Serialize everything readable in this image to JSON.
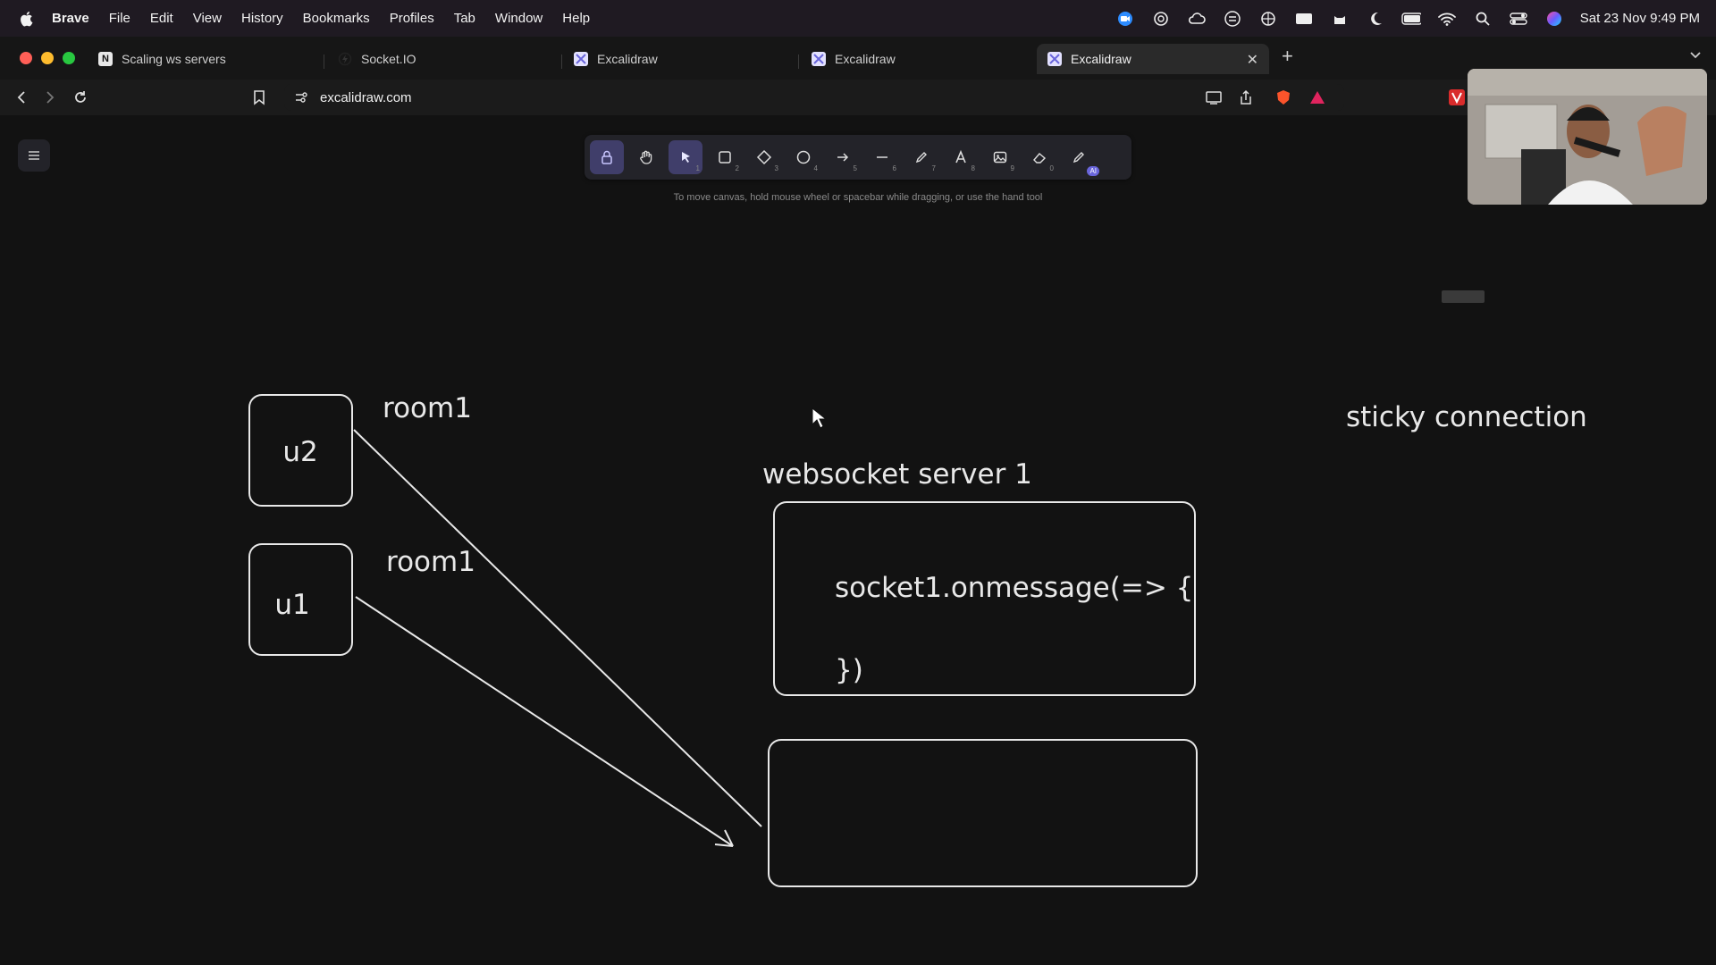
{
  "menubar": {
    "app": "Brave",
    "items": [
      "File",
      "Edit",
      "View",
      "History",
      "Bookmarks",
      "Profiles",
      "Tab",
      "Window",
      "Help"
    ],
    "clock": "Sat 23 Nov  9:49 PM"
  },
  "tabs": [
    {
      "title": "Scaling ws servers",
      "icon": "notion-icon"
    },
    {
      "title": "Socket.IO",
      "icon": "socketio-icon"
    },
    {
      "title": "Excalidraw",
      "icon": "excalidraw-icon"
    },
    {
      "title": "Excalidraw",
      "icon": "excalidraw-icon"
    },
    {
      "title": "Excalidraw",
      "icon": "excalidraw-icon",
      "active": true
    }
  ],
  "address": {
    "url": "excalidraw.com"
  },
  "toolbar": {
    "tools": [
      {
        "name": "lock",
        "key": ""
      },
      {
        "name": "hand",
        "key": ""
      },
      {
        "name": "selection",
        "key": "1"
      },
      {
        "name": "rectangle",
        "key": "2"
      },
      {
        "name": "diamond",
        "key": "3"
      },
      {
        "name": "ellipse",
        "key": "4"
      },
      {
        "name": "arrow",
        "key": "5"
      },
      {
        "name": "line",
        "key": "6"
      },
      {
        "name": "draw",
        "key": "7"
      },
      {
        "name": "text",
        "key": "8"
      },
      {
        "name": "image",
        "key": "9"
      },
      {
        "name": "eraser",
        "key": "0"
      },
      {
        "name": "extra-tools",
        "key": "AI"
      }
    ],
    "hint": "To move canvas, hold mouse wheel or spacebar while dragging, or use the hand tool"
  },
  "drawing": {
    "u2_label": "u2",
    "u1_label": "u1",
    "room1_top": "room1",
    "room1_bottom": "room1",
    "server_title": "websocket server 1",
    "code_line1": "socket1.onmessage(=> {",
    "code_line2": "})",
    "sticky": "sticky connection"
  },
  "colors": {
    "canvas_bg": "#121212",
    "stroke": "#e8e8e8",
    "accent": "#6965db"
  }
}
